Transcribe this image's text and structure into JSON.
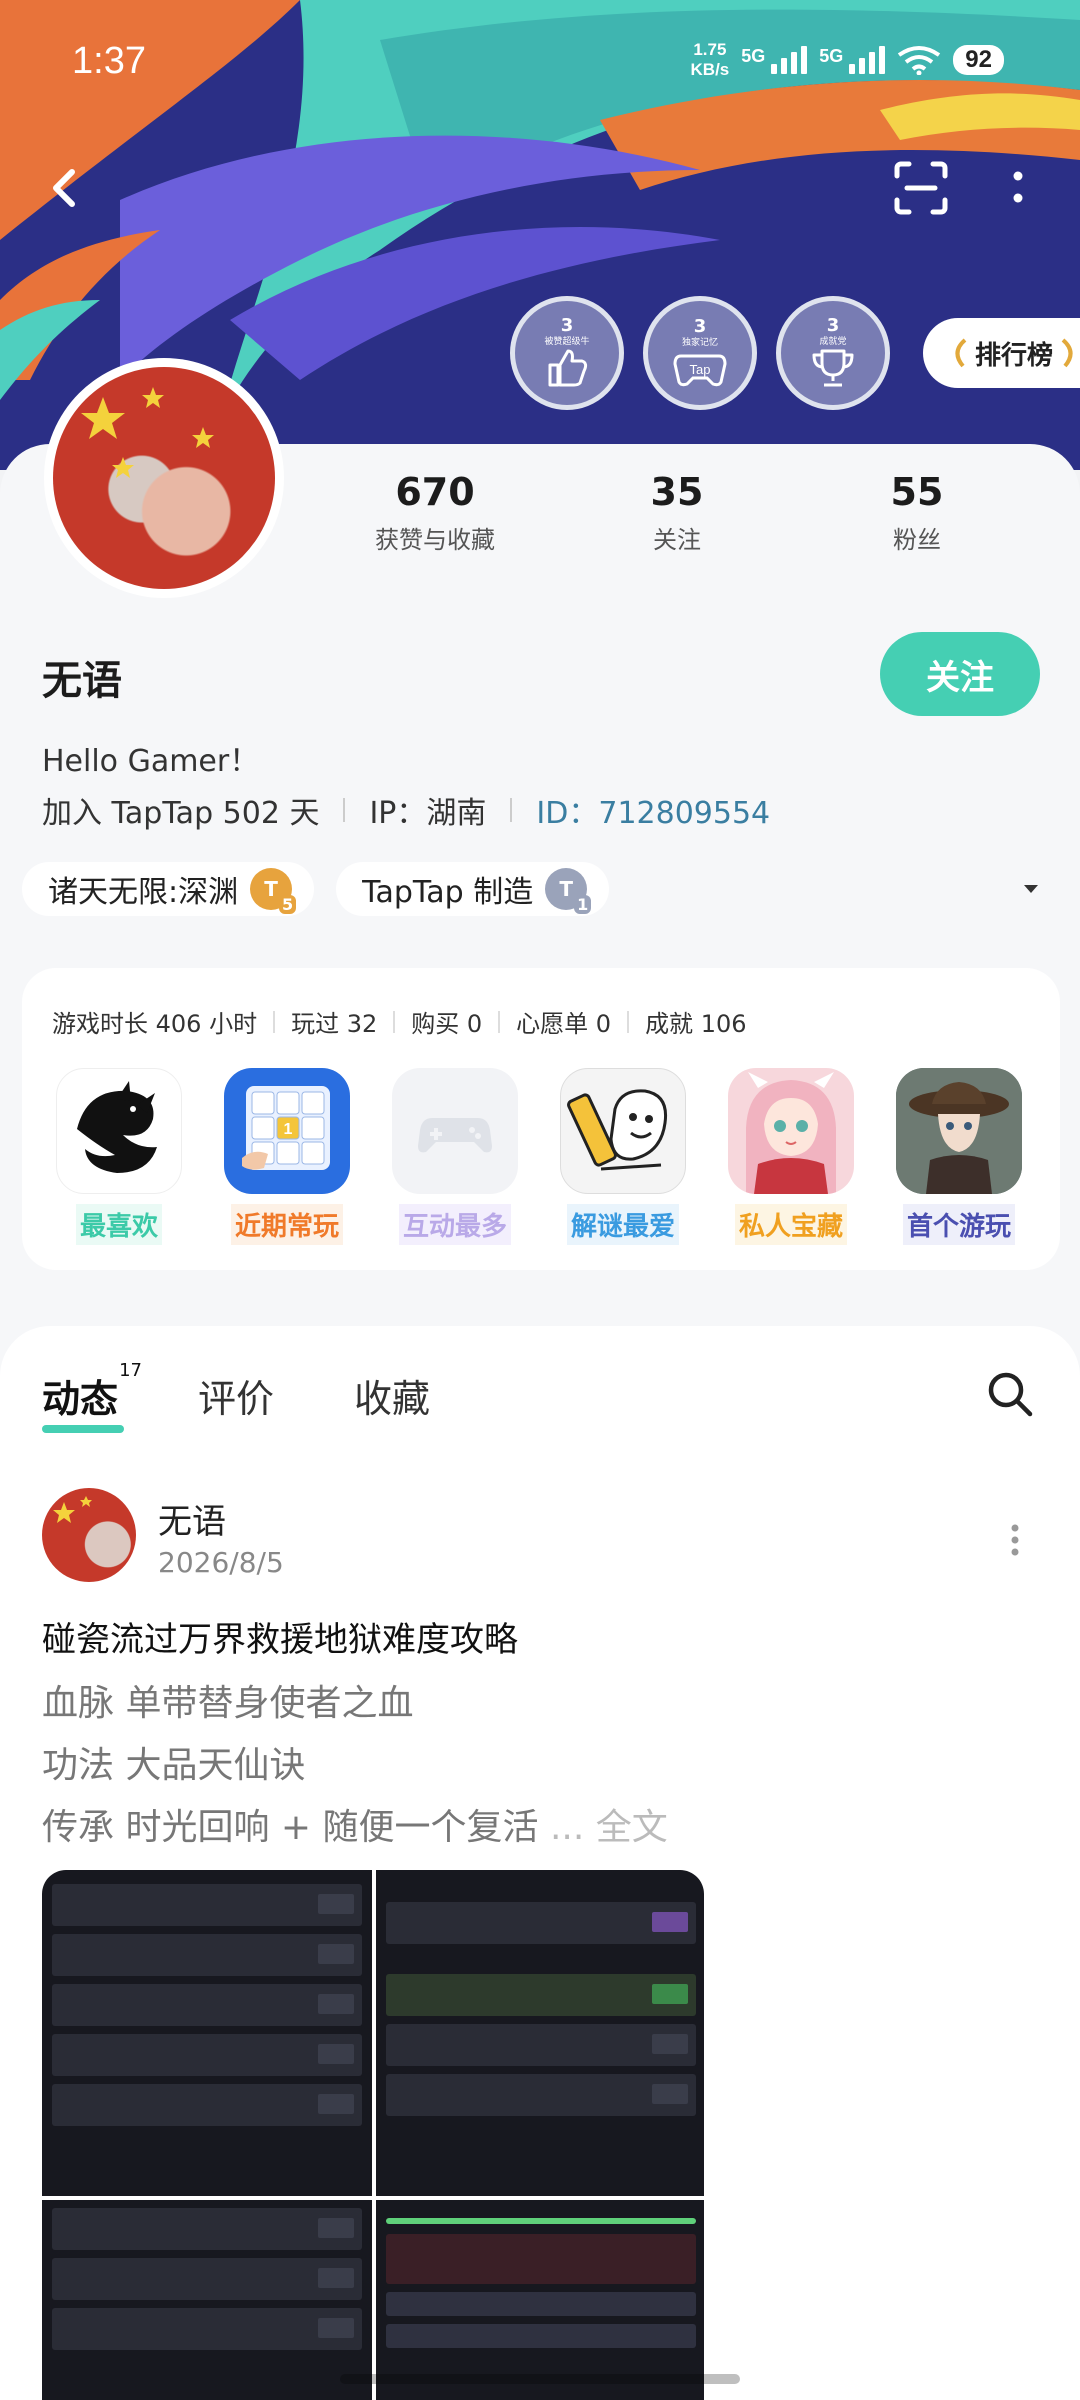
{
  "status_bar": {
    "time": "1:37",
    "net_speed_value": "1.75",
    "net_speed_unit": "KB/s",
    "sim1": "5G",
    "sim2": "5G",
    "battery": "92"
  },
  "header": {
    "badges": [
      {
        "num": "3",
        "sub": "被赞超级牛",
        "icon": "thumbs-up-icon"
      },
      {
        "num": "3",
        "sub": "独家记忆",
        "icon": "tap-gamepad-icon"
      },
      {
        "num": "3",
        "sub": "成就党",
        "icon": "trophy-icon"
      }
    ],
    "rank_label": "排行榜"
  },
  "profile": {
    "stats": [
      {
        "value": "670",
        "label": "获赞与收藏"
      },
      {
        "value": "35",
        "label": "关注"
      },
      {
        "value": "55",
        "label": "粉丝"
      }
    ],
    "username": "无语",
    "follow_label": "关注",
    "bio": "Hello Gamer！",
    "joined": "加入 TapTap 502 天",
    "ip": "IP：湖南",
    "id": "ID：712809554",
    "tags": [
      {
        "label": "诸天无限:深渊",
        "level": "5",
        "coin": "T"
      },
      {
        "label": "TapTap 制造",
        "level": "1",
        "coin": "T"
      }
    ]
  },
  "game_stats": {
    "items": [
      "游戏时长 406 小时",
      "玩过 32",
      "购买 0",
      "心愿单 0",
      "成就 106"
    ],
    "games": [
      {
        "label": "最喜欢",
        "color": "#3ccaa8",
        "bg": "#eafaf5",
        "icon": "dragon-icon"
      },
      {
        "label": "近期常玩",
        "color": "#f07a2a",
        "bg": "#fdf1e6",
        "icon": "sudoku-icon"
      },
      {
        "label": "互动最多",
        "color": "#b9a9e8",
        "bg": "#f3effd",
        "icon": "gamepad-placeholder-icon"
      },
      {
        "label": "解谜最爱",
        "color": "#3a9be0",
        "bg": "#e9f4fc",
        "icon": "pencil-cartoon-icon"
      },
      {
        "label": "私人宝藏",
        "color": "#f0a020",
        "bg": "#fdf5e3",
        "icon": "anime-girl-icon"
      },
      {
        "label": "首个游玩",
        "color": "#4a4fb0",
        "bg": "#eeeffa",
        "icon": "identity-v-icon"
      }
    ]
  },
  "feed": {
    "tabs": [
      {
        "label": "动态",
        "count": "17"
      },
      {
        "label": "评价"
      },
      {
        "label": "收藏"
      }
    ],
    "post": {
      "author": "无语",
      "date": "2026/8/5",
      "title": "碰瓷流过万界救援地狱难度攻略",
      "lines": [
        "血脉 单带替身使者之血",
        "功法 大品天仙诀",
        "传承 时光回响 + 随便一个复活"
      ],
      "ellipsis": " ... ",
      "more": "全文"
    }
  }
}
